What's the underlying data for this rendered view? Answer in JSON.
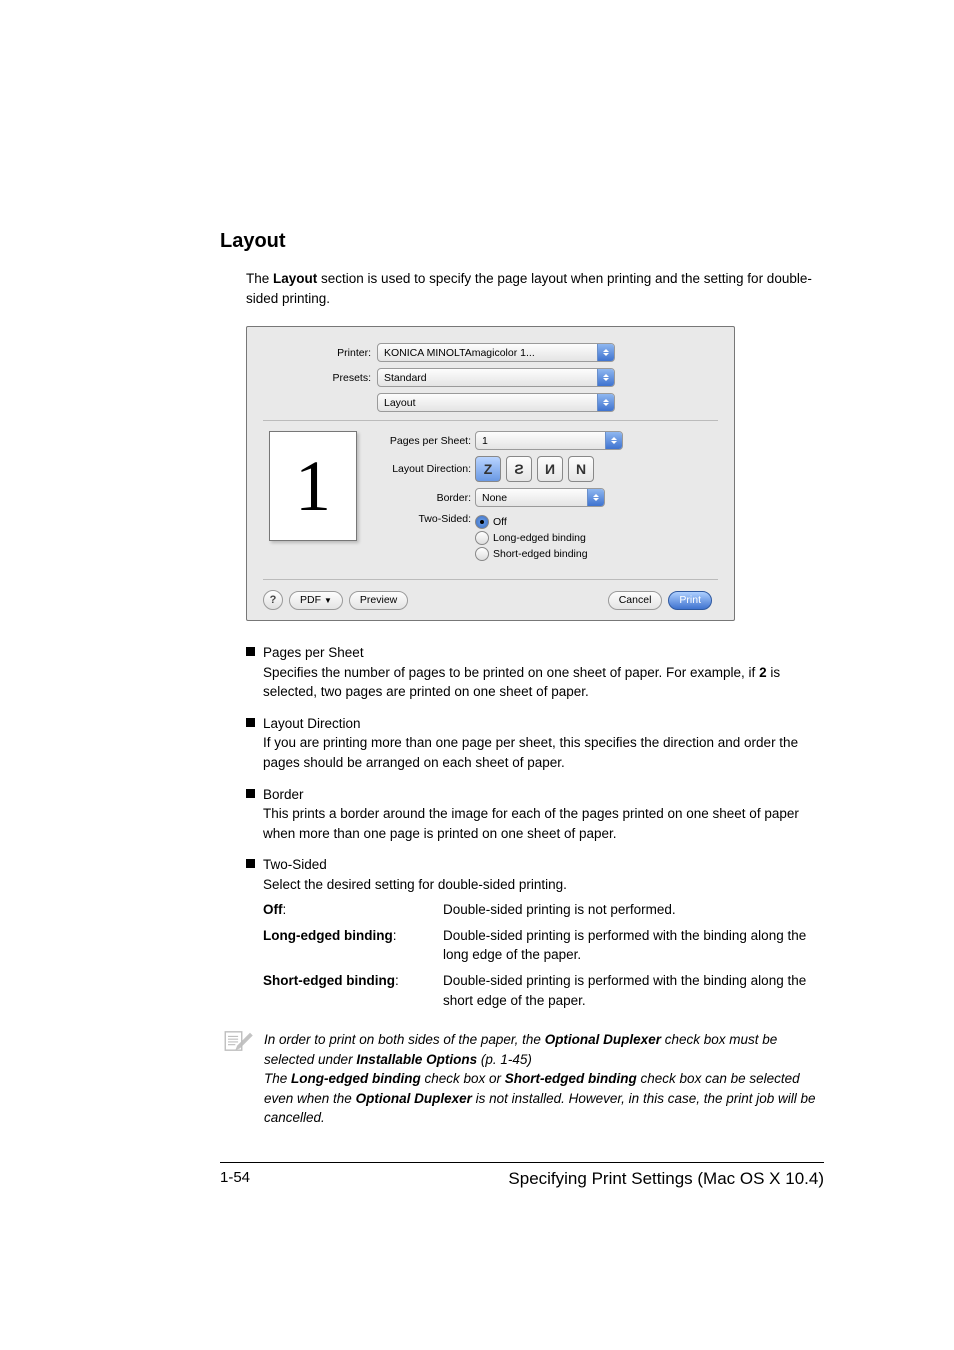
{
  "heading": "Layout",
  "intro_before_bold": "The ",
  "intro_bold": "Layout",
  "intro_after_bold": " section is used to specify the page layout when printing and the setting for double-sided printing.",
  "dialog": {
    "printer_label": "Printer:",
    "printer_value": "KONICA MINOLTAmagicolor 1...",
    "presets_label": "Presets:",
    "presets_value": "Standard",
    "section_value": "Layout",
    "thumb_text": "1",
    "pps_label": "Pages per Sheet:",
    "pps_value": "1",
    "ld_label": "Layout Direction:",
    "border_label": "Border:",
    "border_value": "None",
    "twosided_label": "Two-Sided:",
    "radio_off": "Off",
    "radio_long": "Long-edged binding",
    "radio_short": "Short-edged binding",
    "help": "?",
    "pdf_label": "PDF",
    "preview_label": "Preview",
    "cancel_label": "Cancel",
    "print_label": "Print"
  },
  "bullets": {
    "b1_lead": "Pages per Sheet",
    "b1_body_a": "Specifies the number of pages to be printed on one sheet of paper. For example, if ",
    "b1_body_bold": "2",
    "b1_body_b": " is selected, two pages are printed on one sheet of paper.",
    "b2_lead": "Layout Direction",
    "b2_body": "If you are printing more than one page per sheet, this specifies the direction and order the pages should be arranged on each sheet of paper.",
    "b3_lead": "Border",
    "b3_body": "This prints a border around the image for each of the pages printed on one sheet of paper when more than one page is printed on one sheet of paper.",
    "b4_lead": "Two-Sided",
    "b4_body": "Select the desired setting for double-sided printing.",
    "b4_off_label": "Off",
    "b4_off_colon": ":",
    "b4_off_val": "Double-sided printing is not performed.",
    "b4_long_label": "Long-edged binding",
    "b4_long_colon": ":",
    "b4_long_val": "Double-sided printing is performed with the binding along the long edge of the paper.",
    "b4_short_label": "Short-edged binding",
    "b4_short_colon": ":",
    "b4_short_val": "Double-sided printing is performed with the binding along the short edge of the paper."
  },
  "note": {
    "t1a": "In order to print on both sides of the paper, the ",
    "t1b": "Optional Duplexer",
    "t1c": " check box must be selected under ",
    "t1d": "Installable Options",
    "t1e": " (p. 1-45)",
    "t2a": "The ",
    "t2b": "Long-edged binding",
    "t2c": " check box or ",
    "t2d": "Short-edged binding",
    "t2e": " check box can be selected even when the ",
    "t2f": "Optional Duplexer",
    "t2g": " is not installed. However, in this case, the print job will be cancelled."
  },
  "footer": {
    "left": "1-54",
    "right": "Specifying Print Settings (Mac OS X 10.4)"
  }
}
